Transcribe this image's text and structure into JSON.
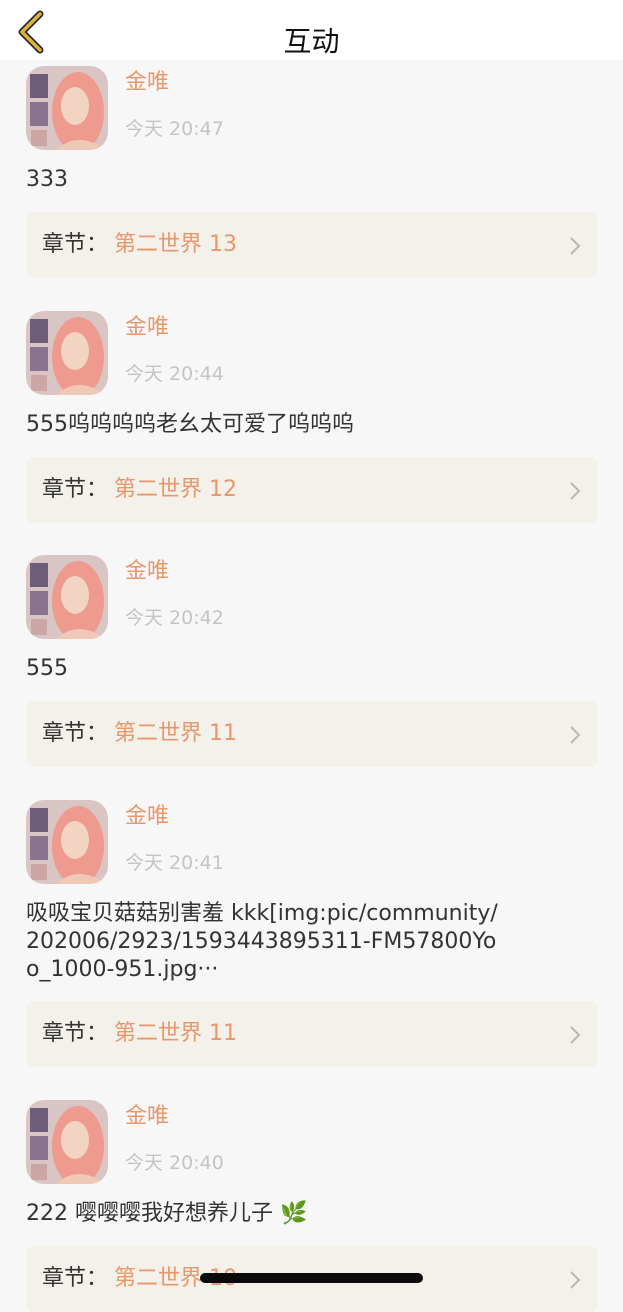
{
  "header": {
    "title": "互动",
    "back_icon": "chevron-left-icon"
  },
  "colors": {
    "accent": "#e8976b",
    "chapter_bg": "#f3f1e9",
    "back_icon": "#e0b23a"
  },
  "chapter_label": "章节：",
  "comments": [
    {
      "user": "金唯",
      "time": "今天 20:47",
      "text": "333",
      "chapter": "第二世界 13"
    },
    {
      "user": "金唯",
      "time": "今天 20:44",
      "text": "555呜呜呜呜老幺太可爱了呜呜呜",
      "chapter": "第二世界 12"
    },
    {
      "user": "金唯",
      "time": "今天 20:42",
      "text": "555",
      "chapter": "第二世界 11"
    },
    {
      "user": "金唯",
      "time": "今天 20:41",
      "text": "吸吸宝贝菇菇别害羞 kkk[img:pic/community/202006/2923/1593443895311-FM57800Yoo_1000-951.jpg···",
      "chapter": "第二世界 11"
    },
    {
      "user": "金唯",
      "time": "今天 20:40",
      "text": "222 嘤嘤嘤我好想养儿子 🌿",
      "chapter": "第二世界 10"
    }
  ]
}
